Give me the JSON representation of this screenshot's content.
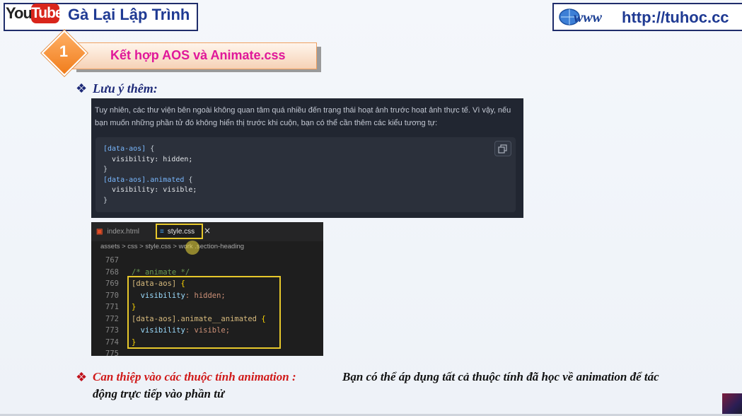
{
  "header": {
    "youtube_you": "You",
    "youtube_tube": "Tube",
    "brand_name": "Gà Lại Lập Trình",
    "site_url": "http://tuhoc.cc"
  },
  "section": {
    "number": "1",
    "title": "Kết hợp AOS và Animate.css"
  },
  "note": {
    "bullet": "❖",
    "heading": "Lưu ý thêm:"
  },
  "doc": {
    "paragraph": "Tuy nhiên, các thư viện bên ngoài không quan tâm quá nhiều đến trạng thái hoạt ảnh trước hoạt ảnh thực tế. Vì vậy, nếu bạn muốn những phần tử đó không hiển thị trước khi cuộn, bạn có thể cần thêm các kiểu tương tự:",
    "code": [
      {
        "sel": "[data-aos]",
        "rest": " {"
      },
      {
        "prop": "  visibility",
        "val": ": hidden;"
      },
      {
        "plain": "}"
      },
      {
        "sel": "[data-aos].animated",
        "rest": " {"
      },
      {
        "prop": "  visibility",
        "val": ": visible;"
      },
      {
        "plain": "}"
      }
    ]
  },
  "editor": {
    "tab_inactive": "index.html",
    "tab_active": "style.css",
    "tab_close": "×",
    "breadcrumb": "assets > css > style.css > work .section-heading",
    "line_numbers": "767\n768\n769\n770\n771\n772\n773\n774\n775",
    "comment": "/* animate */",
    "line1_sel": "[data-aos]",
    "line1_br": " {",
    "line2_prop": "  visibility",
    "line2_val": ": hidden;",
    "line3_br": "}",
    "line4_sel": "[data-aos].animate__animated",
    "line4_br": " {",
    "line5_prop": "  visibility",
    "line5_val": ": visible;",
    "line6_br": "}"
  },
  "bottom": {
    "bullet": "❖",
    "red_text": "Can thiệp vào các thuộc tính animation :",
    "black_text_1": "Bạn có thể áp dụng tất cả thuộc tính đã học về animation để tác",
    "black_text_2": "động trực tiếp vào phần tử"
  },
  "colors": {
    "brand_blue": "#1f3a93",
    "title_magenta": "#e0189a",
    "accent_orange": "#f07d1c",
    "highlight_yellow": "#e7c82b",
    "bottom_red": "#d01818"
  }
}
